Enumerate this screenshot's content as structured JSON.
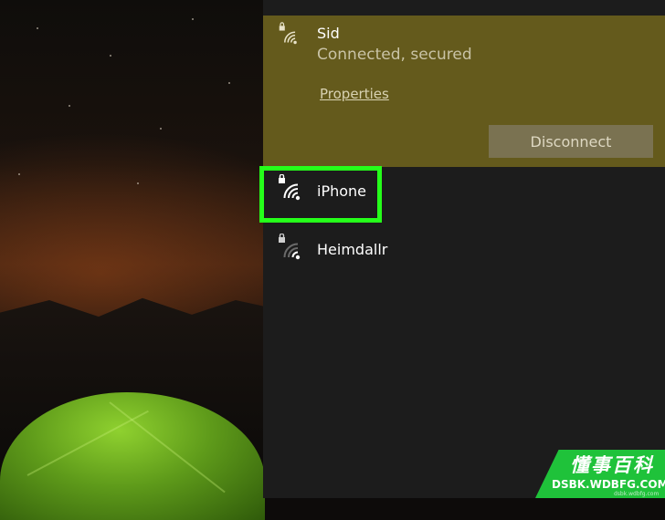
{
  "wallpaper": {
    "accent_tent": "#6fb222"
  },
  "wifi_panel": {
    "connected_network": {
      "name": "Sid",
      "status": "Connected, secured",
      "properties_label": "Properties",
      "disconnect_label": "Disconnect",
      "icon": "wifi-secured-icon"
    },
    "networks": [
      {
        "name": "iPhone",
        "icon": "wifi-secured-icon",
        "highlighted": true
      },
      {
        "name": "Heimdallr",
        "icon": "wifi-secured-icon",
        "highlighted": false
      }
    ],
    "colors": {
      "connected_bg": "#645a1c",
      "panel_bg": "#1c1c1c",
      "highlight_border": "#25ff1a"
    }
  },
  "watermark": {
    "title": "懂事百科",
    "url": "DSBK.WDBFG.COM",
    "small": "dsbk.wdbfg.com"
  }
}
